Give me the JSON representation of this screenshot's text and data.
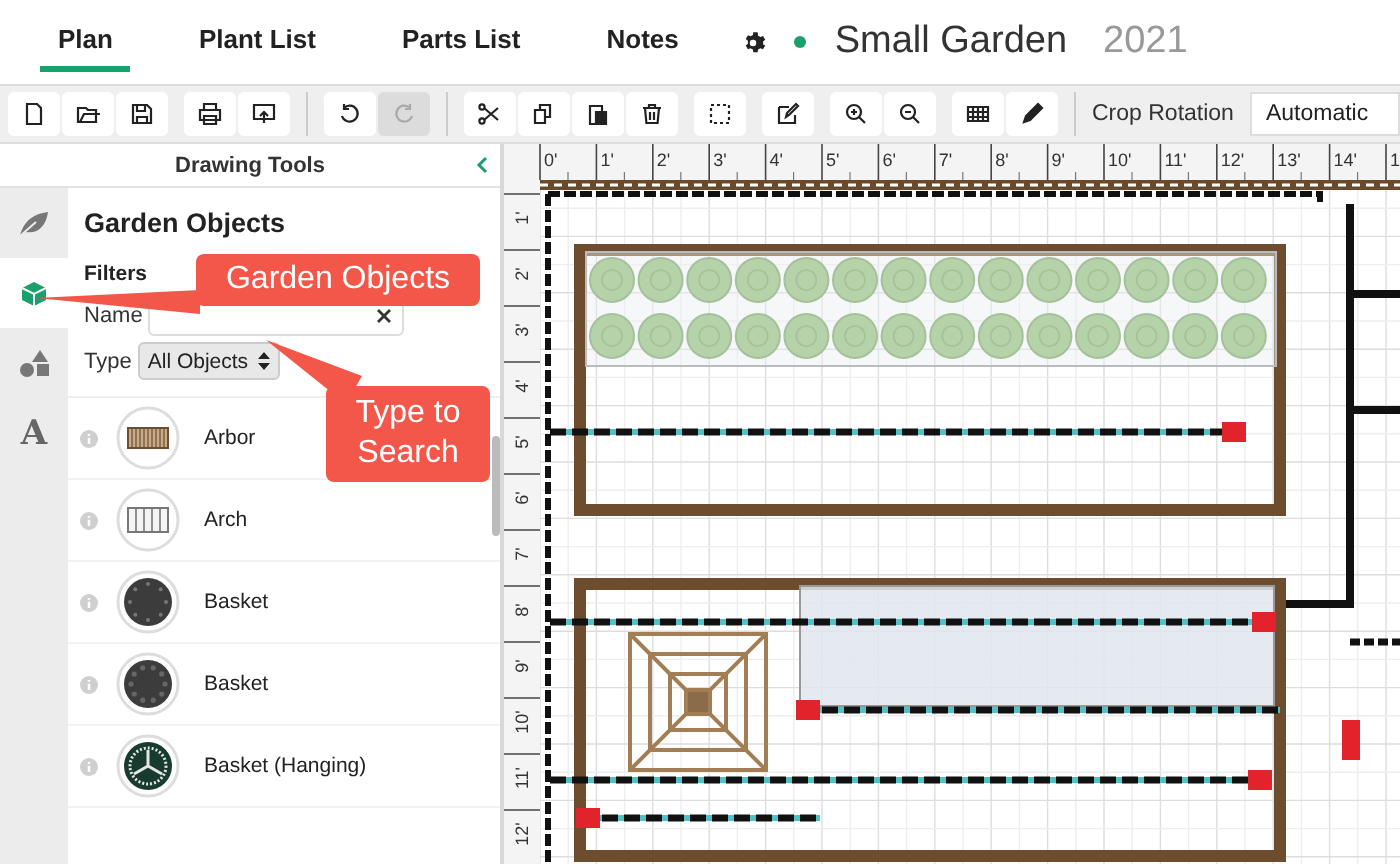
{
  "nav": {
    "tabs": [
      {
        "label": "Plan",
        "selected": true
      },
      {
        "label": "Plant List",
        "selected": false
      },
      {
        "label": "Parts List",
        "selected": false
      },
      {
        "label": "Notes",
        "selected": false
      }
    ],
    "project": {
      "name": "Small Garden",
      "year": "2021"
    }
  },
  "toolbar": {
    "groups": [
      [
        {
          "kind": "new",
          "disabled": false
        },
        {
          "kind": "open",
          "disabled": false
        },
        {
          "kind": "save",
          "disabled": false
        }
      ],
      [
        {
          "kind": "print",
          "disabled": false
        },
        {
          "kind": "export",
          "disabled": false
        }
      ],
      [
        {
          "kind": "undo",
          "disabled": false
        },
        {
          "kind": "redo",
          "disabled": true
        }
      ],
      [
        {
          "kind": "cut",
          "disabled": false
        },
        {
          "kind": "copy",
          "disabled": false
        },
        {
          "kind": "paste",
          "disabled": false
        },
        {
          "kind": "delete",
          "disabled": false
        }
      ],
      [
        {
          "kind": "select",
          "disabled": false
        }
      ],
      [
        {
          "kind": "edit",
          "disabled": false
        }
      ],
      [
        {
          "kind": "zoom_in",
          "disabled": false
        },
        {
          "kind": "zoom_out",
          "disabled": false
        }
      ],
      [
        {
          "kind": "grid",
          "disabled": false
        },
        {
          "kind": "pencil",
          "disabled": false
        }
      ]
    ],
    "crop_rotation": {
      "label": "Crop Rotation",
      "value": "Automatic"
    }
  },
  "drawing_tools": {
    "title": "Drawing Tools",
    "rail": [
      {
        "kind": "leaf",
        "selected": false
      },
      {
        "kind": "cube",
        "selected": true
      },
      {
        "kind": "shapes",
        "selected": false
      },
      {
        "kind": "text",
        "label": "A",
        "selected": false
      }
    ],
    "heading": "Garden Objects",
    "filters": {
      "title": "Filters",
      "name_label": "Name",
      "type_label": "Type",
      "type_value": "All Objects"
    },
    "items": [
      {
        "name": "Arbor",
        "kind": "arbor"
      },
      {
        "name": "Arch",
        "kind": "arch"
      },
      {
        "name": "Basket",
        "kind": "basket"
      },
      {
        "name": "Basket",
        "kind": "basket_dots"
      },
      {
        "name": "Basket (Hanging)",
        "kind": "hanging_basket"
      }
    ]
  },
  "canvas": {
    "top_ruler": [
      "0'",
      "1'",
      "2'",
      "3'",
      "4'",
      "5'",
      "6'",
      "7'",
      "8'",
      "9'",
      "10'",
      "11'",
      "12'",
      "13'",
      "14'",
      "1"
    ],
    "left_ruler": [
      "1'",
      "2'",
      "3'",
      "4'",
      "5'",
      "6'",
      "7'",
      "8'",
      "9'",
      "10'",
      "11'",
      "12'"
    ]
  },
  "callouts": [
    {
      "text": "Garden Objects"
    },
    {
      "text": "Type to Search"
    }
  ]
}
